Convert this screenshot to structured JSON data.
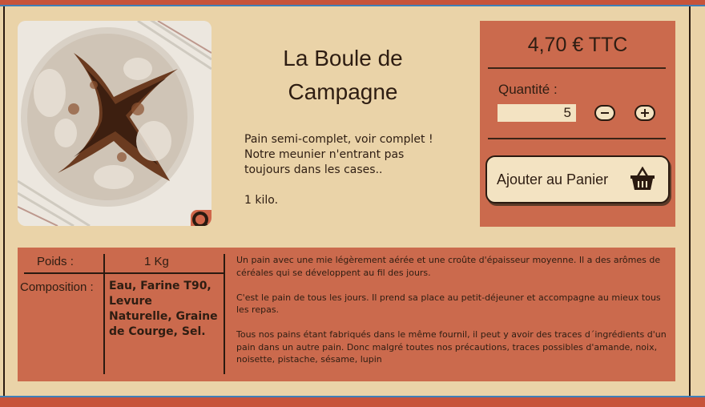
{
  "product": {
    "title": "La Boule de Campagne",
    "description": "Pain semi-complet, voir complet ! Notre meunier n'entrant pas toujours dans les cases..",
    "weight_short": "1 kilo."
  },
  "purchase": {
    "price": "4,70 € TTC",
    "quantity_label": "Quantité :",
    "quantity_value": "5",
    "add_to_cart_label": "Ajouter au Panier"
  },
  "details": {
    "weight_label": "Poids :",
    "weight_value": "1 Kg",
    "composition_label": "Composition :",
    "composition_value": "Eau, Farine T90, Levure Naturelle, Graine de Courge, Sel.",
    "paragraphs": [
      "Un pain avec une mie légèrement aérée et une croûte d'épaisseur moyenne. Il a des arômes de céréales qui se développent au fil des jours.",
      "C'est le pain de tous les jours. Il prend sa place au petit-déjeuner et accompagne au mieux tous les repas.",
      "Tous nos pains étant fabriqués dans le même fournil, il peut y avoir  des traces d´ingrédients d'un pain dans un autre pain. Donc malgré  toutes nos précautions, traces possibles d'amande, noix, noisette, pistache, sésame, lupin"
    ]
  },
  "icons": {
    "zoom": "magnifier-icon",
    "cart": "basket-icon",
    "minus": "minus-icon",
    "plus": "plus-icon"
  },
  "colors": {
    "background": "#ead3a8",
    "accent": "#cb6a4d",
    "stripe_red": "#c7533a",
    "stripe_blue": "#3f7fb8",
    "text": "#2e1d12"
  }
}
